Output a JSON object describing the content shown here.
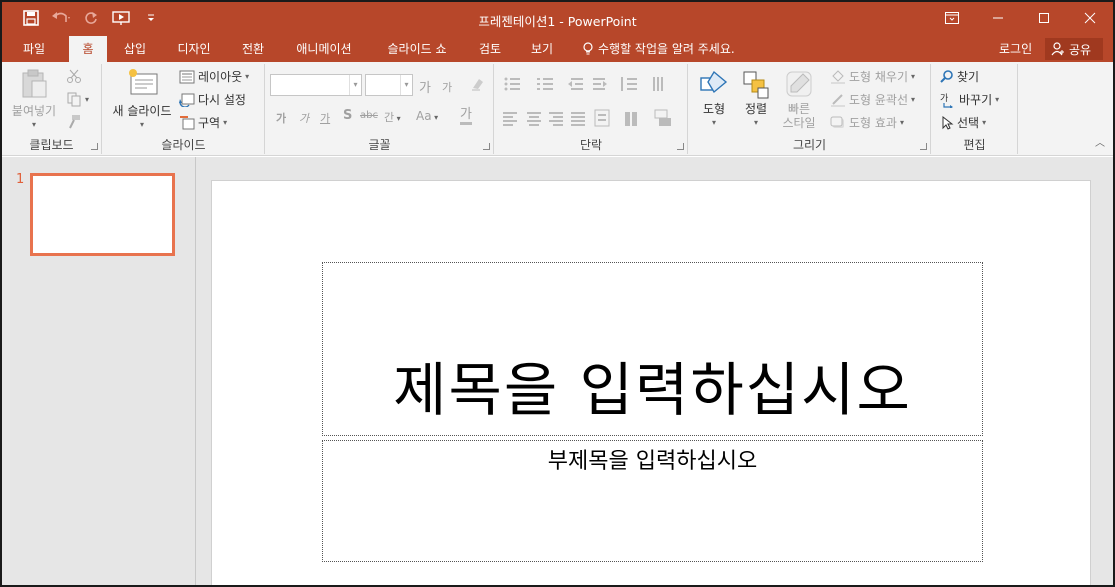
{
  "window": {
    "title": "프레젠테이션1 - PowerPoint"
  },
  "tabs": [
    {
      "label": "파일"
    },
    {
      "label": "홈"
    },
    {
      "label": "삽입"
    },
    {
      "label": "디자인"
    },
    {
      "label": "전환"
    },
    {
      "label": "애니메이션"
    },
    {
      "label": "슬라이드 쇼"
    },
    {
      "label": "검토"
    },
    {
      "label": "보기"
    }
  ],
  "tell_me": "수행할 작업을 알려 주세요.",
  "account": {
    "login": "로그인",
    "share": "공유"
  },
  "ribbon": {
    "clipboard": {
      "group": "클립보드",
      "paste": "붙여넣기"
    },
    "slides": {
      "group": "슬라이드",
      "new_slide": "새 슬라이드",
      "layout": "레이아웃",
      "reset": "다시 설정",
      "section": "구역"
    },
    "font": {
      "group": "글꼴",
      "grow": "가",
      "shrink": "가",
      "bold": "가",
      "italic": "가",
      "underline": "가",
      "shadow": "S",
      "strike": "abc",
      "spacing": "간",
      "case": "Aa",
      "color": "가"
    },
    "paragraph": {
      "group": "단락"
    },
    "drawing": {
      "group": "그리기",
      "shapes": "도형",
      "arrange": "정렬",
      "quick_styles_1": "빠른",
      "quick_styles_2": "스타일",
      "fill": "도형 채우기",
      "outline": "도형 윤곽선",
      "effects": "도형 효과"
    },
    "editing": {
      "group": "편집",
      "find": "찾기",
      "replace": "바꾸기",
      "select": "선택"
    }
  },
  "thumbnails": [
    {
      "number": "1"
    }
  ],
  "slide": {
    "title_placeholder": "제목을 입력하십시오",
    "subtitle_placeholder": "부제목을 입력하십시오"
  },
  "colors": {
    "accent": "#b7472a",
    "thumb_border": "#e8734e"
  }
}
